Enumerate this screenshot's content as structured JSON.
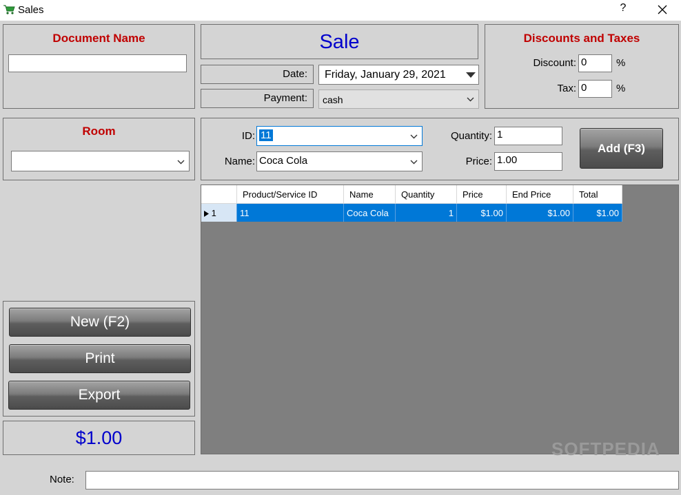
{
  "window": {
    "title": "Sales",
    "help": "?"
  },
  "document": {
    "title": "Document Name",
    "value": ""
  },
  "header": {
    "title": "Sale"
  },
  "date": {
    "label": "Date:",
    "value": "Friday, January 29, 2021"
  },
  "payment": {
    "label": "Payment:",
    "value": "cash"
  },
  "discounts": {
    "title": "Discounts and Taxes",
    "discount_label": "Discount:",
    "discount_value": "0",
    "tax_label": "Tax:",
    "tax_value": "0",
    "percent": "%"
  },
  "room": {
    "title": "Room",
    "value": ""
  },
  "entry": {
    "id_label": "ID:",
    "id_value": "11",
    "name_label": "Name:",
    "name_value": "Coca Cola",
    "quantity_label": "Quantity:",
    "quantity_value": "1",
    "price_label": "Price:",
    "price_value": "1.00",
    "add_label": "Add (F3)"
  },
  "grid": {
    "columns": [
      "Product/Service ID",
      "Name",
      "Quantity",
      "Price",
      "End Price",
      "Total"
    ],
    "rows": [
      {
        "index": "1",
        "cells": [
          "11",
          "Coca Cola",
          "1",
          "$1.00",
          "$1.00",
          "$1.00"
        ]
      }
    ]
  },
  "actions": {
    "new_label": "New (F2)",
    "print_label": "Print",
    "export_label": "Export"
  },
  "total": {
    "value": "$1.00"
  },
  "note": {
    "label": "Note:",
    "value": ""
  },
  "watermark": "SOFTPEDIA",
  "colors": {
    "accent_red": "#c00000",
    "accent_blue": "#0000cc",
    "selection": "#0078d7"
  }
}
